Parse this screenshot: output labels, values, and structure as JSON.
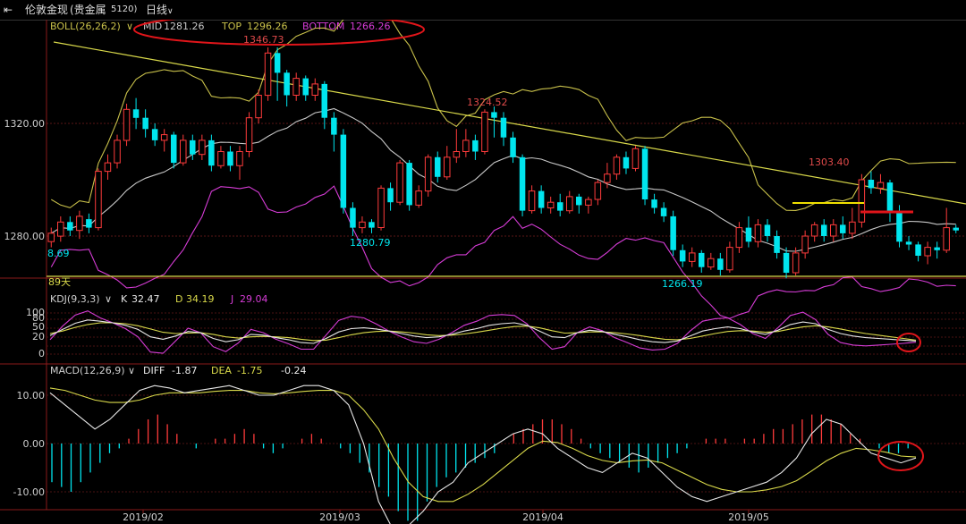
{
  "window": {
    "back_icon": "back-arrow-icon",
    "title": "伦敦金现",
    "subtitle": "(贵金属",
    "code": "5120)",
    "period": "日线"
  },
  "colors": {
    "up": "#ff3b3b",
    "down": "#00e5ee",
    "mid": "#c8c8c8",
    "top": "#c8c04a",
    "bottom": "#d63cd6",
    "trendline": "#d9d94a",
    "kdj_k": "#e8e8e8",
    "kdj_d": "#d9d94a",
    "kdj_j": "#d63cd6",
    "diff": "#e8e8e8",
    "dea": "#d9d94a",
    "annotation": "#e0151a"
  },
  "boll": {
    "label": "BOLL(26,26,2)",
    "mid_label": "MID",
    "mid": "1281.26",
    "top_label": "TOP",
    "top": "1296.26",
    "bottom_label": "BOTTOM",
    "bottom": "1266.26"
  },
  "kdj": {
    "label": "KDJ(9,3,3)",
    "k_label": "K",
    "k": "32.47",
    "d_label": "D",
    "d": "34.19",
    "j_label": "J",
    "j": "29.04"
  },
  "macd": {
    "label": "MACD(12,26,9)",
    "diff_label": "DIFF",
    "diff": "-1.87",
    "dea_label": "DEA",
    "dea": "-1.75",
    "macd": "-0.24"
  },
  "price_labels": {
    "high1": "1346.73",
    "high2": "1324.52",
    "high3": "1303.40",
    "low1": "1280.79",
    "low2": "1266.19",
    "left_cut": "8.69",
    "days": "89天"
  },
  "chart_data": {
    "type": "candlestick",
    "x_ticks": [
      "2019/02",
      "2019/03",
      "2019/04",
      "2019/05"
    ],
    "price_ticks": [
      "1320.00",
      "1280.00"
    ],
    "kdj_ticks": [
      "100",
      "80",
      "50",
      "20",
      "0"
    ],
    "macd_ticks": [
      "10.00",
      "0.00",
      "-10.00"
    ],
    "price_ylim": [
      1254,
      1360
    ],
    "candles": [
      [
        1278,
        1281,
        1276,
        1283
      ],
      [
        1280,
        1285,
        1278,
        1287
      ],
      [
        1285,
        1282,
        1280,
        1287
      ],
      [
        1282,
        1287,
        1279,
        1289
      ],
      [
        1286,
        1283,
        1281,
        1288
      ],
      [
        1283,
        1303,
        1282,
        1304
      ],
      [
        1303,
        1306,
        1300,
        1309
      ],
      [
        1306,
        1314,
        1304,
        1316
      ],
      [
        1314,
        1325,
        1312,
        1327
      ],
      [
        1325,
        1322,
        1318,
        1329
      ],
      [
        1322,
        1318,
        1315,
        1325
      ],
      [
        1318,
        1314,
        1312,
        1320
      ],
      [
        1314,
        1316,
        1310,
        1318
      ],
      [
        1316,
        1306,
        1304,
        1317
      ],
      [
        1306,
        1314,
        1305,
        1316
      ],
      [
        1314,
        1309,
        1307,
        1316
      ],
      [
        1309,
        1314,
        1307,
        1316
      ],
      [
        1314,
        1305,
        1303,
        1316
      ],
      [
        1305,
        1310,
        1304,
        1312
      ],
      [
        1310,
        1305,
        1303,
        1312
      ],
      [
        1305,
        1310,
        1300,
        1312
      ],
      [
        1310,
        1322,
        1308,
        1324
      ],
      [
        1322,
        1330,
        1320,
        1332
      ],
      [
        1330,
        1345,
        1328,
        1347
      ],
      [
        1345,
        1338,
        1328,
        1347
      ],
      [
        1338,
        1330,
        1326,
        1339
      ],
      [
        1330,
        1336,
        1328,
        1338
      ],
      [
        1336,
        1330,
        1328,
        1337
      ],
      [
        1330,
        1334,
        1328,
        1336
      ],
      [
        1334,
        1322,
        1318,
        1335
      ],
      [
        1322,
        1316,
        1310,
        1324
      ],
      [
        1316,
        1290,
        1288,
        1318
      ],
      [
        1290,
        1283,
        1280,
        1292
      ],
      [
        1283,
        1285,
        1281,
        1287
      ],
      [
        1285,
        1283,
        1281,
        1286
      ],
      [
        1283,
        1297,
        1282,
        1298
      ],
      [
        1297,
        1292,
        1289,
        1299
      ],
      [
        1292,
        1306,
        1291,
        1307
      ],
      [
        1306,
        1291,
        1289,
        1307
      ],
      [
        1291,
        1296,
        1290,
        1298
      ],
      [
        1296,
        1308,
        1294,
        1309
      ],
      [
        1308,
        1301,
        1299,
        1310
      ],
      [
        1301,
        1308,
        1300,
        1312
      ],
      [
        1308,
        1310,
        1306,
        1318
      ],
      [
        1310,
        1314,
        1308,
        1318
      ],
      [
        1314,
        1310,
        1307,
        1316
      ],
      [
        1310,
        1324,
        1309,
        1325
      ],
      [
        1324,
        1322,
        1315,
        1326
      ],
      [
        1322,
        1315,
        1312,
        1324
      ],
      [
        1315,
        1308,
        1306,
        1317
      ],
      [
        1308,
        1289,
        1287,
        1309
      ],
      [
        1289,
        1296,
        1288,
        1298
      ],
      [
        1296,
        1290,
        1288,
        1298
      ],
      [
        1290,
        1292,
        1288,
        1294
      ],
      [
        1292,
        1289,
        1287,
        1295
      ],
      [
        1289,
        1294,
        1288,
        1296
      ],
      [
        1294,
        1291,
        1288,
        1295
      ],
      [
        1291,
        1293,
        1288,
        1294
      ],
      [
        1293,
        1299,
        1291,
        1300
      ],
      [
        1299,
        1302,
        1297,
        1306
      ],
      [
        1302,
        1308,
        1300,
        1309
      ],
      [
        1308,
        1304,
        1302,
        1310
      ],
      [
        1304,
        1311,
        1303,
        1312
      ],
      [
        1311,
        1293,
        1291,
        1312
      ],
      [
        1293,
        1290,
        1288,
        1295
      ],
      [
        1290,
        1287,
        1285,
        1292
      ],
      [
        1287,
        1275,
        1273,
        1289
      ],
      [
        1275,
        1271,
        1269,
        1277
      ],
      [
        1271,
        1274,
        1269,
        1276
      ],
      [
        1274,
        1269,
        1267,
        1275
      ],
      [
        1269,
        1272,
        1268,
        1274
      ],
      [
        1272,
        1268,
        1266,
        1274
      ],
      [
        1268,
        1276,
        1267,
        1278
      ],
      [
        1276,
        1283,
        1274,
        1285
      ],
      [
        1283,
        1278,
        1276,
        1287
      ],
      [
        1278,
        1284,
        1276,
        1286
      ],
      [
        1284,
        1280,
        1278,
        1286
      ],
      [
        1280,
        1274,
        1272,
        1282
      ],
      [
        1274,
        1267,
        1265,
        1276
      ],
      [
        1267,
        1274,
        1266,
        1276
      ],
      [
        1274,
        1280,
        1272,
        1282
      ],
      [
        1280,
        1284,
        1278,
        1285
      ],
      [
        1284,
        1280,
        1278,
        1286
      ],
      [
        1280,
        1284,
        1278,
        1286
      ],
      [
        1284,
        1281,
        1279,
        1287
      ],
      [
        1281,
        1285,
        1279,
        1290
      ],
      [
        1285,
        1300,
        1283,
        1302
      ],
      [
        1300,
        1297,
        1295,
        1303
      ],
      [
        1297,
        1299,
        1295,
        1302
      ],
      [
        1299,
        1289,
        1285,
        1300
      ],
      [
        1289,
        1278,
        1276,
        1291
      ],
      [
        1278,
        1277,
        1275,
        1280
      ],
      [
        1277,
        1273,
        1271,
        1278
      ],
      [
        1273,
        1276,
        1270,
        1278
      ],
      [
        1276,
        1275,
        1272,
        1278
      ],
      [
        1275,
        1283,
        1274,
        1290
      ],
      [
        1283,
        1282,
        1281,
        1284
      ]
    ],
    "kdj_k": [
      45,
      60,
      75,
      83,
      80,
      76,
      70,
      60,
      42,
      36,
      44,
      55,
      52,
      38,
      30,
      35,
      48,
      46,
      40,
      35,
      28,
      26,
      38,
      54,
      62,
      64,
      61,
      56,
      50,
      44,
      40,
      42,
      48,
      56,
      62,
      70,
      74,
      76,
      70,
      56,
      42,
      40,
      52,
      58,
      55,
      48,
      42,
      35,
      30,
      28,
      32,
      44,
      56,
      62,
      66,
      62,
      54,
      48,
      58,
      72,
      78,
      74,
      60,
      50,
      44,
      40,
      38,
      36,
      34,
      32
    ],
    "kdj_d": [
      50,
      56,
      65,
      72,
      76,
      76,
      74,
      69,
      61,
      53,
      50,
      51,
      52,
      48,
      42,
      39,
      42,
      43,
      42,
      40,
      36,
      33,
      34,
      40,
      47,
      52,
      55,
      56,
      54,
      51,
      47,
      45,
      46,
      49,
      53,
      58,
      63,
      67,
      68,
      64,
      57,
      51,
      52,
      54,
      54,
      52,
      49,
      45,
      40,
      36,
      35,
      38,
      44,
      50,
      55,
      57,
      56,
      53,
      55,
      61,
      66,
      69,
      66,
      61,
      55,
      50,
      46,
      42,
      38,
      34
    ],
    "kdj_j": [
      35,
      68,
      95,
      105,
      88,
      76,
      62,
      42,
      5,
      2,
      32,
      63,
      52,
      18,
      6,
      27,
      60,
      52,
      36,
      25,
      12,
      12,
      46,
      82,
      92,
      88,
      73,
      56,
      42,
      30,
      26,
      36,
      52,
      70,
      80,
      94,
      96,
      94,
      74,
      40,
      12,
      18,
      52,
      66,
      57,
      40,
      28,
      15,
      10,
      12,
      26,
      56,
      80,
      86,
      88,
      72,
      50,
      38,
      64,
      94,
      102,
      84,
      48,
      28,
      22,
      20,
      22,
      24,
      26,
      29
    ],
    "macd_diff": [
      10.5,
      8,
      5.5,
      3,
      5,
      8,
      11,
      12,
      11.5,
      10.5,
      11,
      11.5,
      12,
      11,
      10,
      10,
      11,
      12,
      12,
      11,
      8,
      0,
      -12,
      -18,
      -17,
      -14,
      -10,
      -8,
      -4,
      -2,
      0,
      2,
      3,
      2,
      -1,
      -3,
      -5,
      -6,
      -4,
      -2,
      -3,
      -6,
      -9,
      -11,
      -12,
      -11,
      -10,
      -9,
      -8,
      -6,
      -3,
      2,
      5,
      4,
      1,
      -2,
      -3,
      -4,
      -3
    ],
    "macd_dea": [
      11.5,
      11,
      10,
      9,
      8.5,
      8.5,
      9,
      10,
      10.5,
      10.5,
      10.5,
      10.8,
      11,
      11,
      10.5,
      10.3,
      10.5,
      10.8,
      11,
      11,
      10,
      7,
      3,
      -3,
      -8,
      -11,
      -12,
      -12,
      -10.5,
      -8.5,
      -6,
      -3.5,
      -1,
      0.5,
      0.2,
      -1,
      -2.5,
      -3.5,
      -4,
      -3.6,
      -3.4,
      -4,
      -5.5,
      -7,
      -8.5,
      -9.5,
      -10,
      -10,
      -9.6,
      -8.9,
      -7.7,
      -5.7,
      -3.6,
      -2,
      -1,
      -1.3,
      -1.8,
      -2.6,
      -2.8
    ],
    "macd_bar": [
      -8,
      -9,
      -10,
      -8,
      -6,
      -4,
      -2,
      -1,
      1,
      3,
      5,
      6,
      4,
      2,
      0,
      -1,
      0,
      1,
      1,
      2,
      3,
      2,
      -1,
      -2,
      -1,
      0,
      1,
      2,
      1,
      0,
      -1,
      -2,
      -4,
      -6,
      -9,
      -11,
      -14,
      -16,
      -16,
      -12,
      -9,
      -7,
      -6,
      -5,
      -4,
      -3,
      -2,
      0,
      2,
      3,
      4,
      5,
      5,
      4,
      3,
      1,
      -1,
      -2,
      -3,
      -4,
      -5,
      -6,
      -5,
      -4,
      -3,
      -2,
      -1,
      0,
      1,
      1,
      1,
      0,
      1,
      1,
      2,
      3,
      3,
      4,
      5,
      6,
      6,
      5,
      4,
      2,
      1,
      0,
      -1,
      -2,
      -2,
      -1
    ]
  }
}
